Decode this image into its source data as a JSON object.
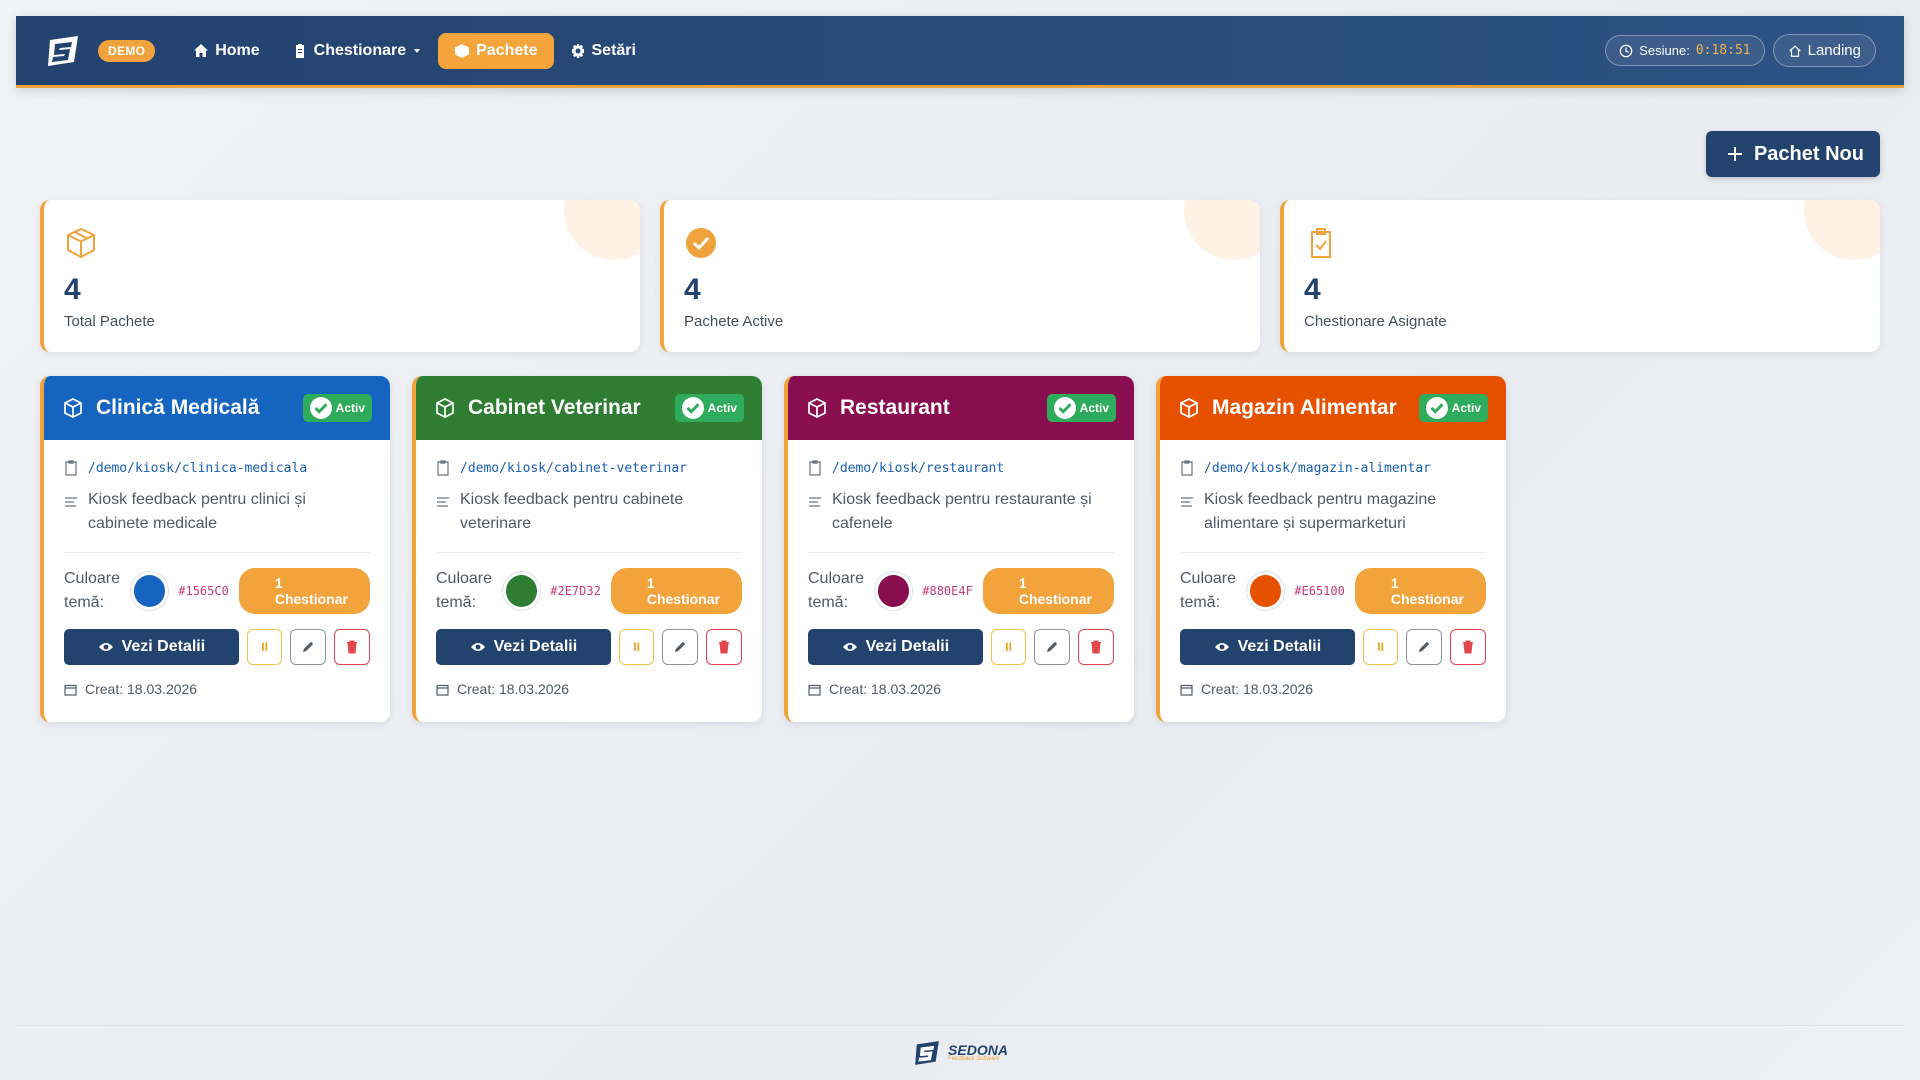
{
  "nav": {
    "demo_badge": "DEMO",
    "items": [
      {
        "label": "Home",
        "icon": "home-icon"
      },
      {
        "label": "Chestionare",
        "icon": "clipboard-icon"
      },
      {
        "label": "Pachete",
        "icon": "box-icon"
      },
      {
        "label": "Setări",
        "icon": "gear-icon"
      }
    ],
    "session_label": "Sesiune:",
    "session_time": "0:18:51",
    "landing_label": "Landing"
  },
  "new_package_label": "Pachet Nou",
  "stats": [
    {
      "value": "4",
      "label": "Total Pachete",
      "icon": "box-icon"
    },
    {
      "value": "4",
      "label": "Pachete Active",
      "icon": "check-circle-icon"
    },
    {
      "value": "4",
      "label": "Chestionare Asignate",
      "icon": "clipboard-check-icon"
    }
  ],
  "cards": [
    {
      "title": "Clinică Medicală",
      "status": "Activ",
      "path": "/demo/kiosk/clinica-medicala",
      "description": "Kiosk feedback pentru clinici și cabinete medicale",
      "theme_label": "Culoare temă:",
      "color": "#1565C0",
      "questionnaires": "1 Chestionar",
      "details_label": "Vezi Detalii",
      "pause_label": "II",
      "created": "Creat: 18.03.2026"
    },
    {
      "title": "Cabinet Veterinar",
      "status": "Activ",
      "path": "/demo/kiosk/cabinet-veterinar",
      "description": "Kiosk feedback pentru cabinete veterinare",
      "theme_label": "Culoare temă:",
      "color": "#2E7D32",
      "questionnaires": "1 Chestionar",
      "details_label": "Vezi Detalii",
      "pause_label": "II",
      "created": "Creat: 18.03.2026"
    },
    {
      "title": "Restaurant",
      "status": "Activ",
      "path": "/demo/kiosk/restaurant",
      "description": "Kiosk feedback pentru restaurante și cafenele",
      "theme_label": "Culoare temă:",
      "color": "#880E4F",
      "questionnaires": "1 Chestionar",
      "details_label": "Vezi Detalii",
      "pause_label": "II",
      "created": "Creat: 18.03.2026"
    },
    {
      "title": "Magazin Alimentar",
      "status": "Activ",
      "path": "/demo/kiosk/magazin-alimentar",
      "description": "Kiosk feedback pentru magazine alimentare și supermarketuri",
      "theme_label": "Culoare temă:",
      "color": "#E65100",
      "questionnaires": "1 Chestionar",
      "details_label": "Vezi Detalii",
      "pause_label": "II",
      "created": "Creat: 18.03.2026"
    }
  ],
  "footer": {
    "brand": "SEDONA",
    "tagline": "Feedback Software"
  }
}
